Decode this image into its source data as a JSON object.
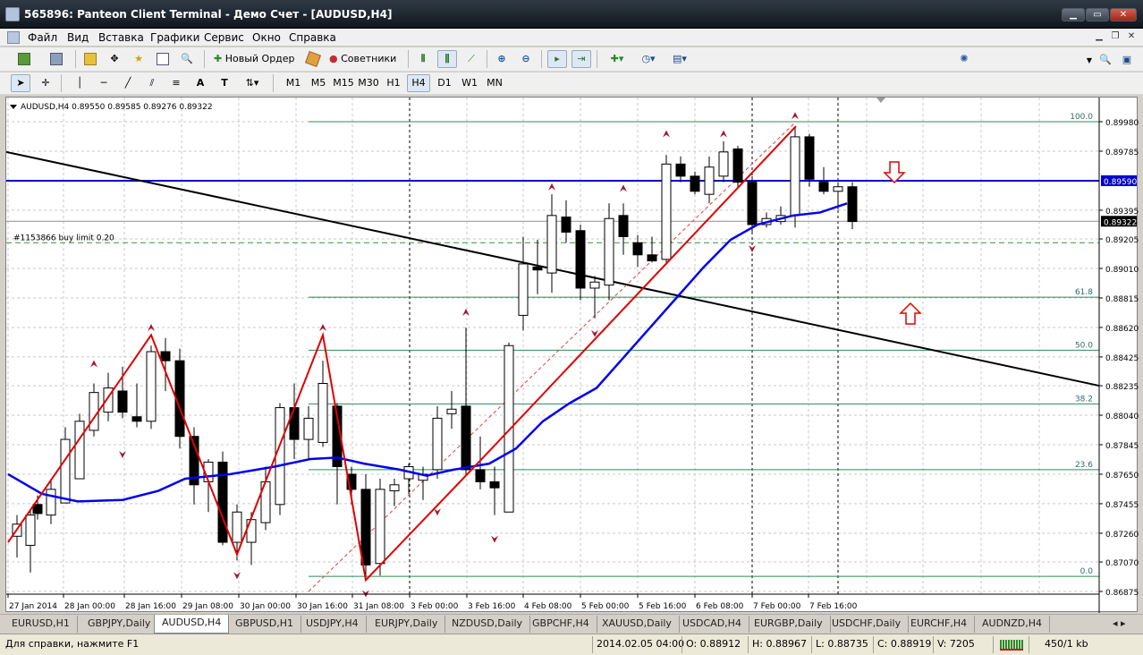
{
  "window": {
    "title": "565896: Panteon Client Terminal - Демо Счет - [AUDUSD,H4]",
    "minimize": "▁",
    "maximize": "▭",
    "close": "✕"
  },
  "menu": [
    "Файл",
    "Вид",
    "Вставка",
    "Графики",
    "Сервис",
    "Окно",
    "Справка"
  ],
  "toolbar": {
    "new_order": "Новый Ордер",
    "advisors": "Советники"
  },
  "timeframes": [
    "M1",
    "M5",
    "M15",
    "M30",
    "H1",
    "H4",
    "D1",
    "W1",
    "MN"
  ],
  "active_timeframe": "H4",
  "chart": {
    "header": "AUDUSD,H4  0.89550 0.89585 0.89276 0.89322",
    "order_label": "#1153866 buy limit 0.20",
    "price_labels": [
      "0.89980",
      "0.89785",
      "0.89395",
      "0.89205",
      "0.89010",
      "0.88815",
      "0.88620",
      "0.88425",
      "0.88235",
      "0.88040",
      "0.87845",
      "0.87650",
      "0.87455",
      "0.87260",
      "0.87070",
      "0.86875"
    ],
    "level_price": "0.89590",
    "current_price": "0.89322",
    "fib_labels": [
      "100.0",
      "61.8",
      "50.0",
      "38.2",
      "23.6",
      "0.0"
    ],
    "time_labels": [
      "27 Jan 2014",
      "28 Jan 00:00",
      "28 Jan 16:00",
      "29 Jan 08:00",
      "30 Jan 00:00",
      "30 Jan 16:00",
      "31 Jan 08:00",
      "3 Feb 00:00",
      "3 Feb 16:00",
      "4 Feb 08:00",
      "5 Feb 00:00",
      "5 Feb 16:00",
      "6 Feb 08:00",
      "7 Feb 00:00",
      "7 Feb 16:00"
    ]
  },
  "tabs": [
    "EURUSD,H1",
    "GBPJPY,Daily",
    "AUDUSD,H4",
    "GBPUSD,H1",
    "USDJPY,H4",
    "EURJPY,Daily",
    "NZDUSD,Daily",
    "GBPCHF,H4",
    "XAUUSD,Daily",
    "USDCAD,H4",
    "EURGBP,Daily",
    "USDCHF,Daily",
    "EURCHF,H4",
    "AUDNZD,H4"
  ],
  "active_tab": "AUDUSD,H4",
  "status": {
    "help": "Для справки, нажмите F1",
    "datetime": "2014.02.05 04:00",
    "open": "O: 0.88912",
    "high": "H: 0.88967",
    "low": "L: 0.88735",
    "close": "C: 0.88919",
    "volume": "V: 7205",
    "traffic": "450/1 kb"
  },
  "colors": {
    "level_line": "#0000cc",
    "zigzag": "#e00000",
    "ma": "#0000ee",
    "trend": "#000000",
    "fib": "#2e8b57"
  }
}
